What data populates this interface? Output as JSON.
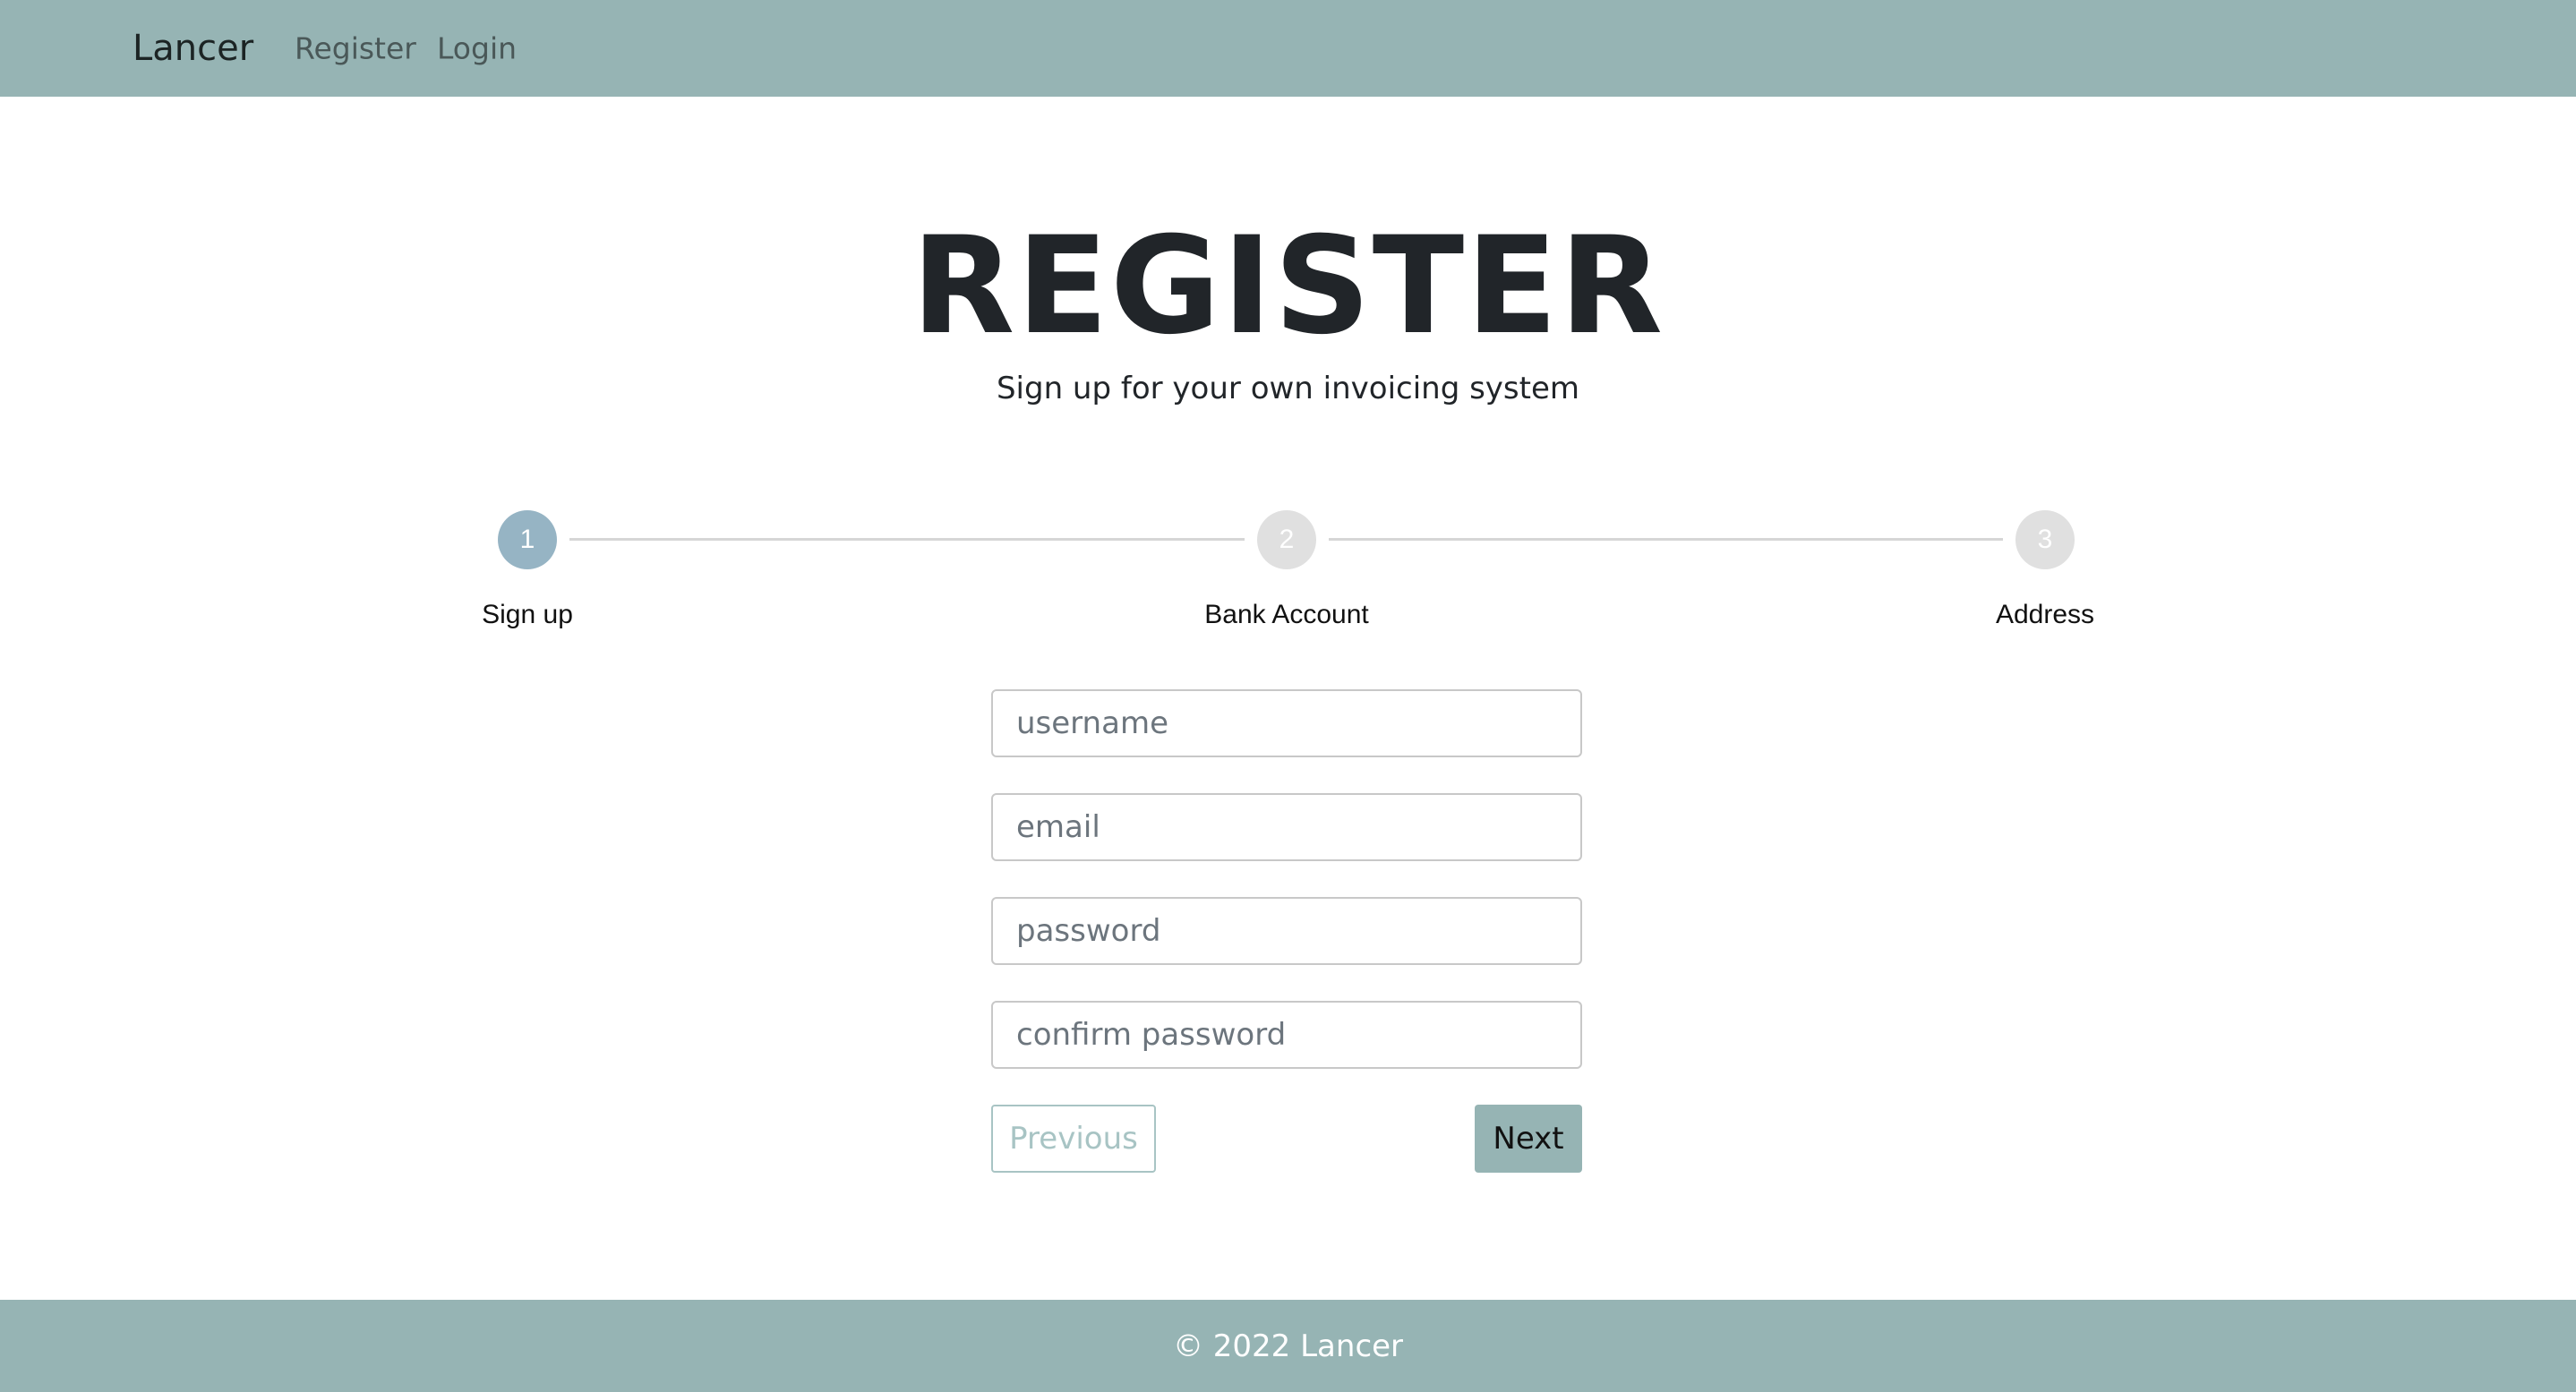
{
  "navbar": {
    "brand": "Lancer",
    "links": [
      "Register",
      "Login"
    ],
    "background": "#96b4b4"
  },
  "hero": {
    "title": "REGISTER",
    "subtitle": "Sign up for your own invoicing system"
  },
  "stepper": {
    "steps": [
      {
        "number": "1",
        "label": "Sign up",
        "state": "active"
      },
      {
        "number": "2",
        "label": "Bank Account",
        "state": "inactive"
      },
      {
        "number": "3",
        "label": "Address",
        "state": "inactive"
      }
    ],
    "active_color": "#96b4c4",
    "inactive_color": "#e0e0e0"
  },
  "form": {
    "fields": [
      {
        "name": "username",
        "placeholder": "username",
        "value": ""
      },
      {
        "name": "email",
        "placeholder": "email",
        "value": ""
      },
      {
        "name": "password",
        "placeholder": "password",
        "value": ""
      },
      {
        "name": "confirm-password",
        "placeholder": "confirm password",
        "value": ""
      }
    ],
    "previous_label": "Previous",
    "next_label": "Next"
  },
  "footer": {
    "text": "© 2022 Lancer"
  }
}
